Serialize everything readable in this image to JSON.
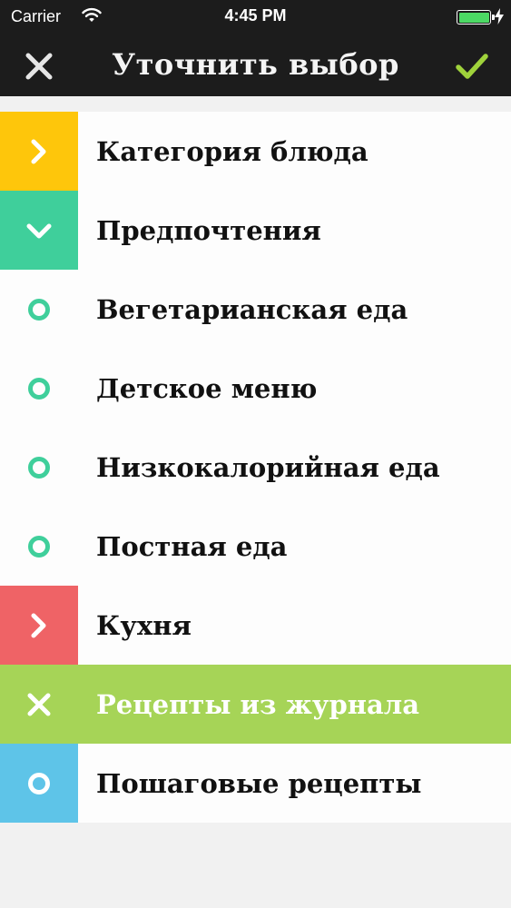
{
  "status_bar": {
    "carrier": "Carrier",
    "time": "4:45 PM",
    "battery_level": 1.0
  },
  "nav": {
    "title": "Уточнить выбор",
    "close_icon": "close-icon",
    "confirm_icon": "checkmark-icon"
  },
  "colors": {
    "yellow": "#fec60b",
    "teal": "#3fcf9b",
    "red": "#ef6366",
    "green": "#a6d457",
    "blue": "#5ec4e8",
    "dark": "#1c1c1c",
    "check": "#9fd23b"
  },
  "list": {
    "items": [
      {
        "label": "Категория блюда",
        "icon": "chevron-right-icon",
        "color": "#fec60b",
        "type": "category"
      },
      {
        "label": "Предпочтения",
        "icon": "chevron-down-icon",
        "color": "#3fcf9b",
        "type": "category-expanded"
      },
      {
        "label": "Вегетарианская еда",
        "icon": "radio-icon",
        "color": "#3fcf9b",
        "type": "option"
      },
      {
        "label": "Детское меню",
        "icon": "radio-icon",
        "color": "#3fcf9b",
        "type": "option"
      },
      {
        "label": "Низкокалорийная еда",
        "icon": "radio-icon",
        "color": "#3fcf9b",
        "type": "option"
      },
      {
        "label": "Постная еда",
        "icon": "radio-icon",
        "color": "#3fcf9b",
        "type": "option"
      },
      {
        "label": "Кухня",
        "icon": "chevron-right-icon",
        "color": "#ef6366",
        "type": "category"
      },
      {
        "label": "Рецепты из журнала",
        "icon": "close-icon",
        "color": "#a6d457",
        "type": "selected-filter"
      },
      {
        "label": "Пошаговые рецепты",
        "icon": "radio-icon",
        "color": "#5ec4e8",
        "type": "filter"
      }
    ]
  }
}
